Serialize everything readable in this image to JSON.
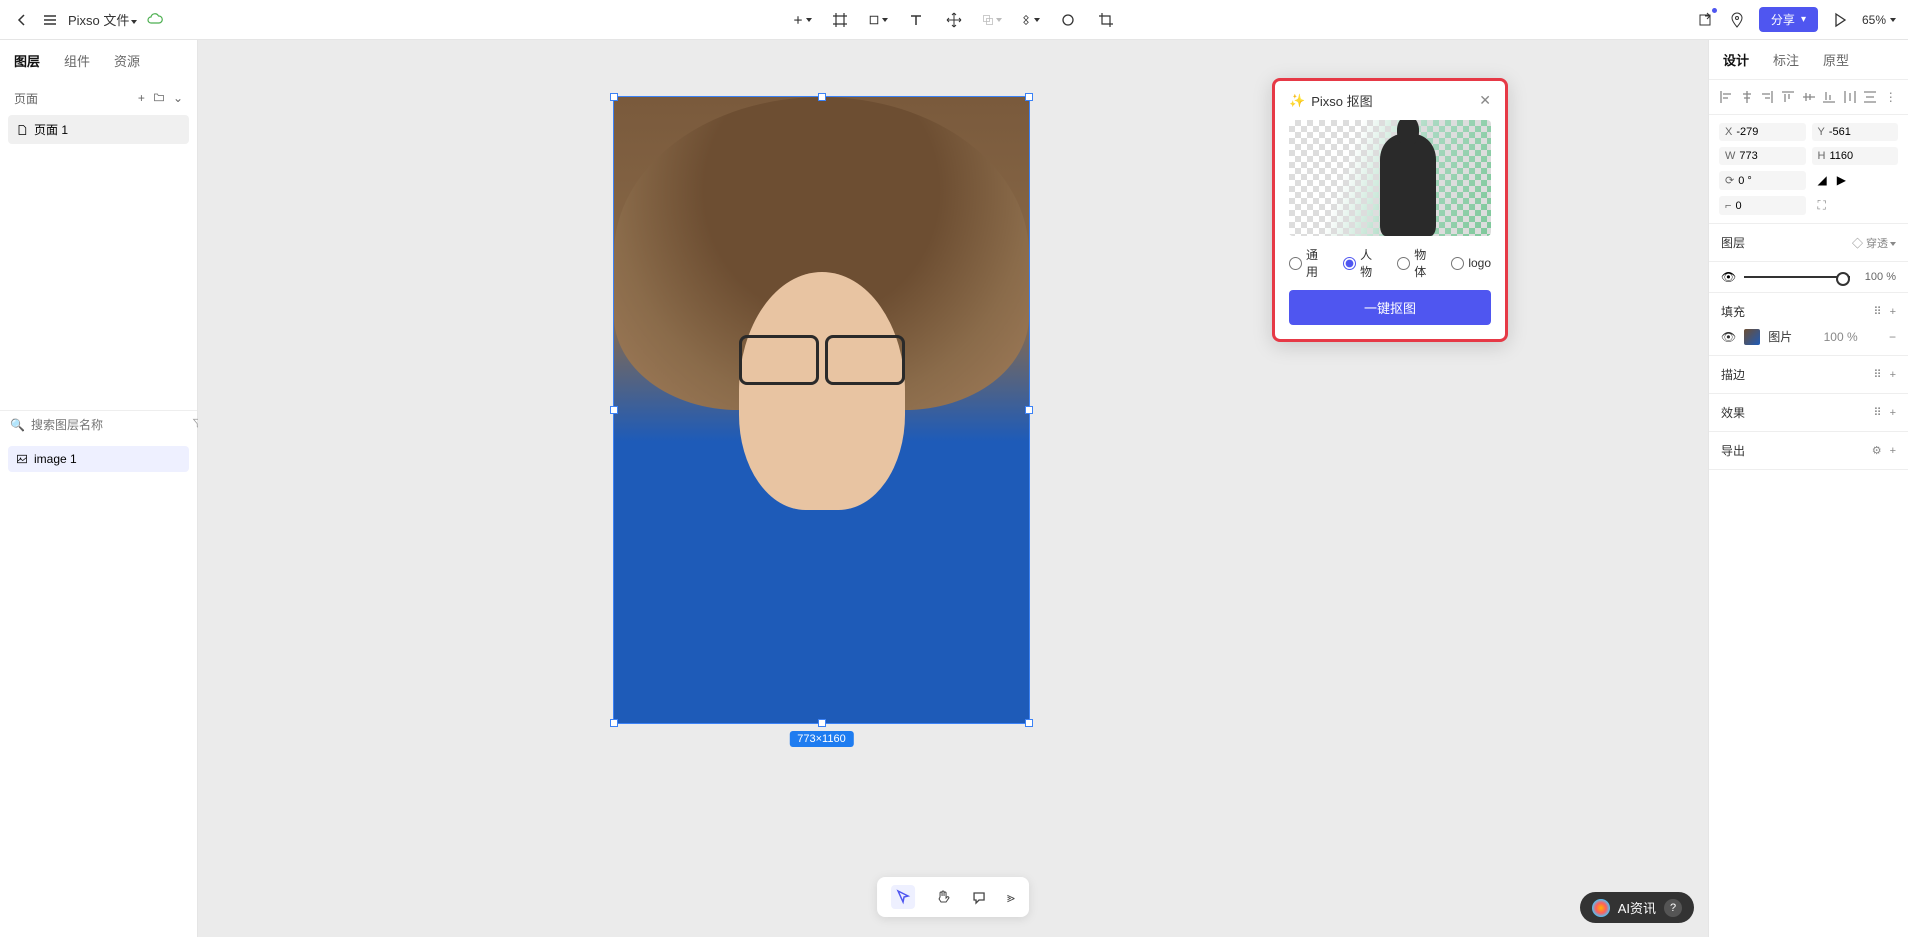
{
  "topbar": {
    "file_name": "Pixso 文件",
    "share_label": "分享",
    "zoom": "65%"
  },
  "left_panel": {
    "tabs": [
      "图层",
      "组件",
      "资源"
    ],
    "pages_header": "页面",
    "pages": [
      "页面 1"
    ],
    "search_placeholder": "搜索图层名称",
    "layers": [
      "image 1"
    ]
  },
  "canvas": {
    "selection_dimensions": "773×1160"
  },
  "popup": {
    "title": "Pixso 抠图",
    "options": [
      "通用",
      "人物",
      "物体",
      "logo"
    ],
    "selected_option": "人物",
    "action_button": "一键抠图"
  },
  "right_panel": {
    "tabs": [
      "设计",
      "标注",
      "原型"
    ],
    "transform": {
      "x": "-279",
      "y": "-561",
      "w": "773",
      "h": "1160",
      "rotation": "0 °",
      "radius": "0"
    },
    "sections": {
      "layer": {
        "label": "图层",
        "passthrough": "穿透"
      },
      "opacity": "100",
      "fill": {
        "label": "填充",
        "type": "图片",
        "value": "100"
      },
      "stroke": {
        "label": "描边"
      },
      "effects": {
        "label": "效果"
      },
      "export": {
        "label": "导出"
      }
    }
  },
  "help_badge": "AI资讯"
}
